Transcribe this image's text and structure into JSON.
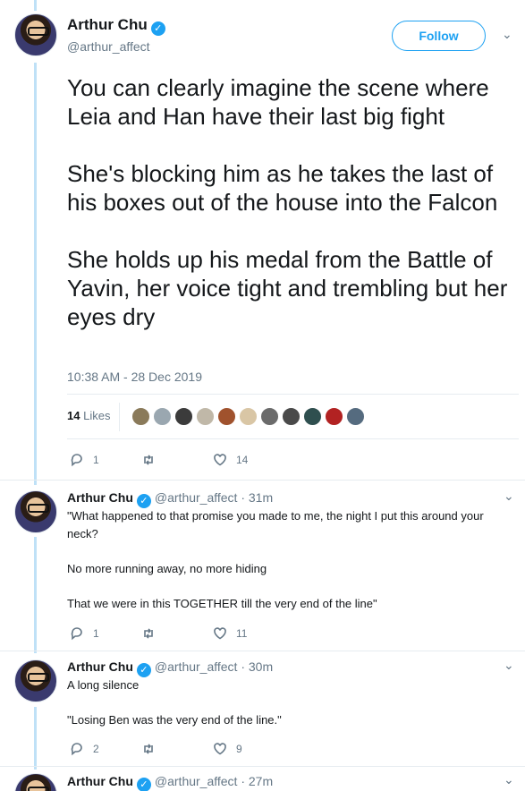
{
  "main": {
    "name": "Arthur Chu",
    "handle": "@arthur_affect",
    "follow_label": "Follow",
    "text": "You can clearly imagine the scene where Leia and Han have their last big fight\n\nShe's blocking him as he takes the last of his boxes out of the house into the Falcon\n\nShe holds up his medal from the Battle of Yavin, her voice tight and trembling but her eyes dry",
    "timestamp": "10:38 AM - 28 Dec 2019",
    "likes_count": "14",
    "likes_label": "Likes",
    "actions": {
      "replies": "1",
      "retweets": "",
      "likes": "14"
    }
  },
  "replies": [
    {
      "name": "Arthur Chu",
      "handle_time": "@arthur_affect · 31m",
      "text": "\"What happened to that promise you made to me, the night I put this around your neck?\n\nNo more running away, no more hiding\n\nThat we were in this TOGETHER till the very end of the line\"",
      "actions": {
        "replies": "1",
        "retweets": "",
        "likes": "11"
      }
    },
    {
      "name": "Arthur Chu",
      "handle_time": "@arthur_affect · 30m",
      "text": "A long silence\n\n\"Losing Ben was the very end of the line.\"",
      "actions": {
        "replies": "2",
        "retweets": "",
        "likes": "9"
      }
    },
    {
      "name": "Arthur Chu",
      "handle_time": "@arthur_affect · 27m"
    }
  ],
  "colors": {
    "accent": "#1da1f2",
    "thread_line": "#bfe1f7",
    "muted": "#657786",
    "text": "#14171a"
  },
  "icons": [
    "verified-badge-icon",
    "chevron-down-icon",
    "reply-icon",
    "retweet-icon",
    "heart-icon"
  ]
}
